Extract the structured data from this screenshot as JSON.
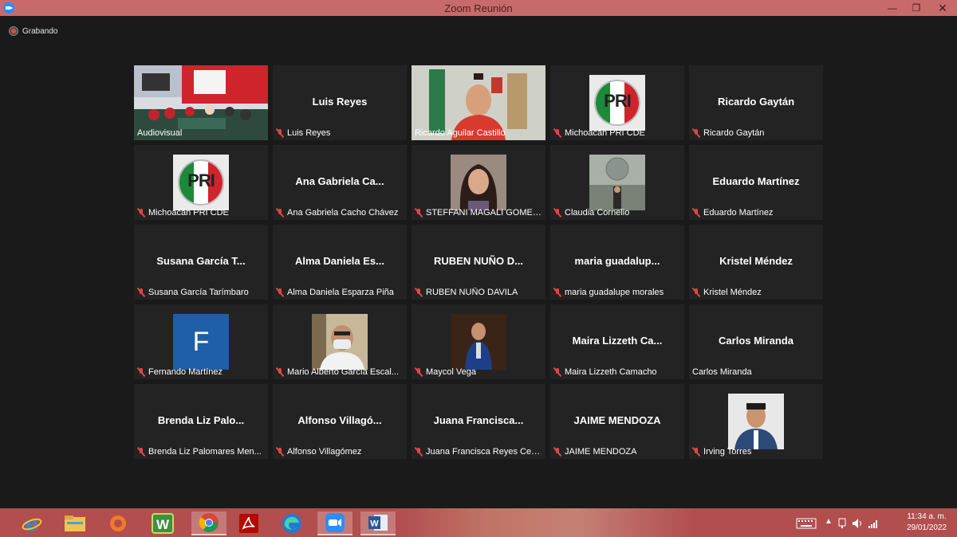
{
  "window": {
    "title": "Zoom Reunión"
  },
  "recording": {
    "label": "Grabando"
  },
  "tiles": [
    {
      "big": "",
      "label": "Audiovisual",
      "muted": false,
      "video": "room"
    },
    {
      "big": "Luis Reyes",
      "label": "Luis Reyes",
      "muted": true
    },
    {
      "big": "",
      "label": "Ricardo Aguilar Castillo",
      "muted": false,
      "video": "speaker",
      "active": true
    },
    {
      "big": "",
      "label": "Michoacán PRI CDE",
      "muted": true,
      "video": "pri",
      "pri_text": "PRI"
    },
    {
      "big": "Ricardo Gaytán",
      "label": "Ricardo Gaytán",
      "muted": true
    },
    {
      "big": "",
      "label": "Michoacán PRI CDE",
      "muted": true,
      "video": "pri",
      "pri_text": "PRI"
    },
    {
      "big": "Ana Gabriela Ca...",
      "label": "Ana Gabriela Cacho Chávez",
      "muted": true
    },
    {
      "big": "",
      "label": "STEFFANI MAGALI GOMEZ ...",
      "muted": true,
      "video": "woman"
    },
    {
      "big": "",
      "label": "Claudia Cornelio",
      "muted": true,
      "video": "seal"
    },
    {
      "big": "Eduardo Martínez",
      "label": "Eduardo Martínez",
      "muted": true
    },
    {
      "big": "Susana García T...",
      "label": "Susana García Tarímbaro",
      "muted": true
    },
    {
      "big": "Alma Daniela Es...",
      "label": "Alma Daniela Esparza Piña",
      "muted": true
    },
    {
      "big": "RUBEN NUÑO D...",
      "label": "RUBEN NUÑO DAVILA",
      "muted": true
    },
    {
      "big": "maria guadalup...",
      "label": "maria guadalupe morales",
      "muted": true
    },
    {
      "big": "Kristel Méndez",
      "label": "Kristel Méndez",
      "muted": true
    },
    {
      "big": "",
      "label": "Fernando Martínez",
      "muted": true,
      "video": "letter",
      "letter": "F"
    },
    {
      "big": "",
      "label": "Mario Alberto García Escal...",
      "muted": true,
      "video": "mask"
    },
    {
      "big": "",
      "label": "Maycol Vega",
      "muted": true,
      "video": "suit"
    },
    {
      "big": "Maira Lizzeth Ca...",
      "label": "Maira Lizzeth Camacho",
      "muted": true
    },
    {
      "big": "Carlos Miranda",
      "label": "Carlos Miranda",
      "muted": false
    },
    {
      "big": "Brenda Liz Palo...",
      "label": "Brenda Liz Palomares Men...",
      "muted": true
    },
    {
      "big": "Alfonso Villagó...",
      "label": "Alfonso Villagómez",
      "muted": true
    },
    {
      "big": "Juana Francisca...",
      "label": "Juana Francisca Reyes Cerv...",
      "muted": true
    },
    {
      "big": "JAIME MENDOZA",
      "label": "JAIME MENDOZA",
      "muted": true
    },
    {
      "big": "",
      "label": "Irving Torres",
      "muted": true,
      "video": "man"
    }
  ],
  "taskbar": {
    "apps": [
      "internet-explorer-icon",
      "file-explorer-icon",
      "orange-app-icon",
      "w-app-icon",
      "chrome-icon",
      "acrobat-icon",
      "edge-icon",
      "zoom-icon",
      "word-icon"
    ]
  },
  "tray": {
    "time": "11:34 a. m.",
    "date": "29/01/2022"
  }
}
